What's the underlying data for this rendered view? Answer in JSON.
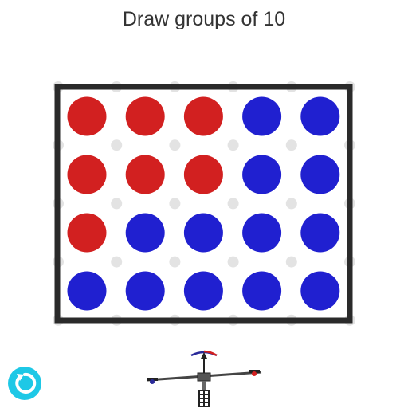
{
  "title": "Draw groups of 10",
  "colors": {
    "red": "#d22020",
    "blue": "#2020d0",
    "frame": "#2a2a2a",
    "peg": "#e3e3e3",
    "reset": "#1ec8e6"
  },
  "rows": [
    [
      "red",
      "red",
      "red",
      "blue",
      "blue"
    ],
    [
      "red",
      "red",
      "red",
      "blue",
      "blue"
    ],
    [
      "red",
      "blue",
      "blue",
      "blue",
      "blue"
    ],
    [
      "blue",
      "blue",
      "blue",
      "blue",
      "blue"
    ]
  ],
  "icons": {
    "reset": "rotate-ccw-icon",
    "tool": "scale-balance-icon"
  }
}
